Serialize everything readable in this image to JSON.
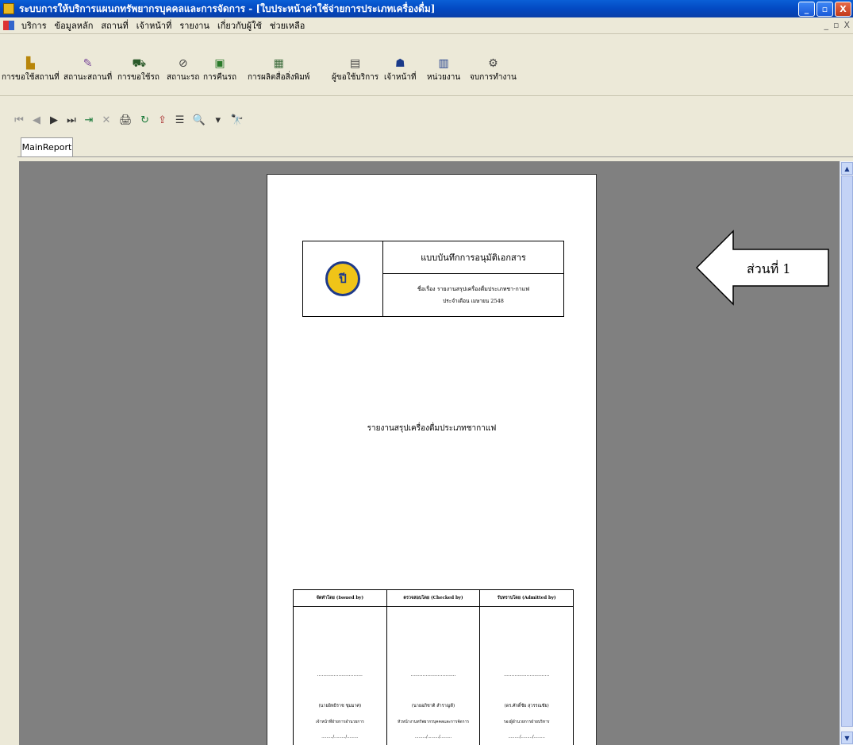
{
  "window": {
    "title": "ระบบการให้บริการแผนกทรัพยากรบุคคลและการจัดการ - [ใบประหน้าค่าใช้จ่ายการประเภทเครื่องดื่ม]",
    "buttons": {
      "minimize": "_",
      "maximize": "▫",
      "close": "X"
    }
  },
  "menu": {
    "items": [
      "บริการ",
      "ข้อมูลหลัก",
      "สถานที่",
      "เจ้าหน้าที่",
      "รายงาน",
      "เกี่ยวกับผู้ใช้",
      "ช่วยเหลือ"
    ],
    "mdi_controls": [
      "_",
      "▫",
      "X"
    ]
  },
  "toolbar": {
    "buttons": [
      {
        "label": "การขอใช้สถานที่",
        "icon": "building-icon"
      },
      {
        "label": "สถานะสถานที่",
        "icon": "pencil-icon"
      },
      {
        "label": "การขอใช้รถ",
        "icon": "car-icon"
      },
      {
        "label": "สถานะรถ",
        "icon": "car-outline-icon"
      },
      {
        "label": "การคืนรถ",
        "icon": "return-icon"
      },
      {
        "label": "การผลิตสื่อสิ่งพิมพ์",
        "icon": "printer-icon"
      },
      {
        "label": "ผู้ขอใช้บริการ",
        "icon": "form-icon"
      },
      {
        "label": "เจ้าหน้าที่",
        "icon": "staff-icon"
      },
      {
        "label": "หน่วยงาน",
        "icon": "unit-icon"
      },
      {
        "label": "จบการทำงาน",
        "icon": "exit-icon"
      }
    ]
  },
  "report_nav": {
    "glyphs": [
      "⏮",
      "◀",
      "▶",
      "⏭",
      "⇥",
      "✕",
      "🖨",
      "↻",
      "⇪",
      "☰",
      "🔍",
      "▾",
      "🔭"
    ]
  },
  "tab": {
    "label": "MainReport"
  },
  "report": {
    "header_title": "แบบบันทึกการอนุมัติเอกสาร",
    "header_subject": "ชื่อเรื่อง รายงานสรุปเครื่องดื่มประเภทชา-กาแฟ",
    "header_date": "ประจำเดือน เมษายน 2548",
    "logo_text": "ปี",
    "main_title": "รายงานสรุปเครื่องดื่มประเภทชากาแฟ",
    "signatures": [
      {
        "header": "จัดทำโดย (Issued by)",
        "dots": "..............................",
        "name": "(นายอิทธิราช ชุมมาศ)",
        "position": "เจ้าหน้าที่ฝ่ายการอำนวยการ",
        "date": "........./........./........."
      },
      {
        "header": "ตรวจสอบโดย (Checked by)",
        "dots": "..............................",
        "name": "(นายอภิชาติ สำราญดี)",
        "position": "หัวหน้างานทรัพยากรบุคคลและการจัดการ",
        "date": "........./........./........."
      },
      {
        "header": "รับทราบโดย (Admitted by)",
        "dots": "..............................",
        "name": "(ดร.ศักดิ์ชัย สุวรรณชัย)",
        "position": "รองผู้อำนวยการฝ่ายบริหาร",
        "date": "........./........./........."
      }
    ]
  },
  "callout": {
    "text": "ส่วนที่ 1"
  },
  "colors": {
    "titlebar": "#0a5fd6",
    "preview_bg": "#808080",
    "workspace": "#ece9d8"
  }
}
